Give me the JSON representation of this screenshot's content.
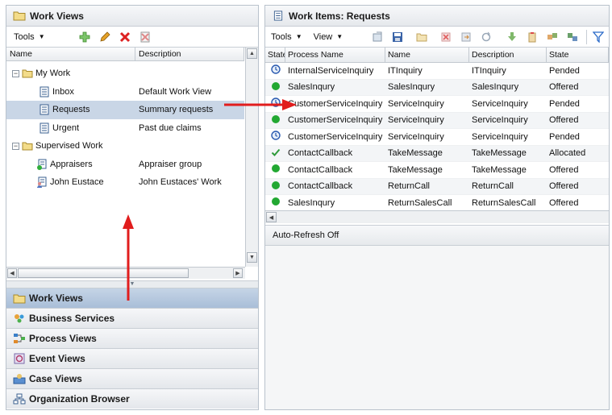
{
  "colors": {
    "accent_selected": "#c9d6e6",
    "annotation_arrow": "#e11d1d",
    "accordion_active": "#b5c8de"
  },
  "left_panel": {
    "title": "Work Views",
    "toolbar": {
      "tools_label": "Tools"
    },
    "columns": [
      "Name",
      "Description"
    ],
    "tree": [
      {
        "name": "My Work",
        "description": "",
        "level": 0,
        "icon": "folder-icon",
        "expander": "−"
      },
      {
        "name": "Inbox",
        "description": "Default Work View",
        "level": 1,
        "icon": "list-icon"
      },
      {
        "name": "Requests",
        "description": "Summary requests",
        "level": 1,
        "icon": "list-icon",
        "selected": true
      },
      {
        "name": "Urgent",
        "description": "Past due claims",
        "level": 1,
        "icon": "list-icon"
      },
      {
        "name": "Supervised Work",
        "description": "",
        "level": 0,
        "icon": "folder-icon",
        "expander": "−"
      },
      {
        "name": "Appraisers",
        "description": "Appraiser group",
        "level": 1,
        "icon": "group-list-icon"
      },
      {
        "name": "John Eustace",
        "description": "John Eustaces' Work",
        "level": 1,
        "icon": "user-list-icon"
      }
    ]
  },
  "accordion": [
    {
      "label": "Work Views",
      "icon": "folder-icon",
      "active": true
    },
    {
      "label": "Business Services",
      "icon": "services-icon"
    },
    {
      "label": "Process Views",
      "icon": "process-icon"
    },
    {
      "label": "Event Views",
      "icon": "event-icon"
    },
    {
      "label": "Case Views",
      "icon": "case-icon"
    },
    {
      "label": "Organization Browser",
      "icon": "org-icon"
    }
  ],
  "right_panel": {
    "title": "Work Items: Requests",
    "toolbar": {
      "tools_label": "Tools",
      "view_label": "View"
    },
    "columns": [
      "State",
      "Process Name",
      "Name",
      "Description",
      "State"
    ],
    "rows": [
      {
        "status": "clock",
        "process": "InternalServiceInquiry",
        "name": "ITInquiry",
        "description": "ITInquiry",
        "state": "Pended"
      },
      {
        "status": "green",
        "process": "SalesInqury",
        "name": "SalesInqury",
        "description": "SalesInqury",
        "state": "Offered"
      },
      {
        "status": "clock",
        "process": "CustomerServiceInquiry",
        "name": "ServiceInquiry",
        "description": "ServiceInquiry",
        "state": "Pended"
      },
      {
        "status": "green",
        "process": "CustomerServiceInquiry",
        "name": "ServiceInquiry",
        "description": "ServiceInquiry",
        "state": "Offered"
      },
      {
        "status": "clock",
        "process": "CustomerServiceInquiry",
        "name": "ServiceInquiry",
        "description": "ServiceInquiry",
        "state": "Pended"
      },
      {
        "status": "check",
        "process": "ContactCallback",
        "name": "TakeMessage",
        "description": "TakeMessage",
        "state": "Allocated"
      },
      {
        "status": "green",
        "process": "ContactCallback",
        "name": "TakeMessage",
        "description": "TakeMessage",
        "state": "Offered"
      },
      {
        "status": "green",
        "process": "ContactCallback",
        "name": "ReturnCall",
        "description": "ReturnCall",
        "state": "Offered"
      },
      {
        "status": "green",
        "process": "SalesInqury",
        "name": "ReturnSalesCall",
        "description": "ReturnSalesCall",
        "state": "Offered"
      }
    ],
    "status_bar": "Auto-Refresh Off"
  }
}
